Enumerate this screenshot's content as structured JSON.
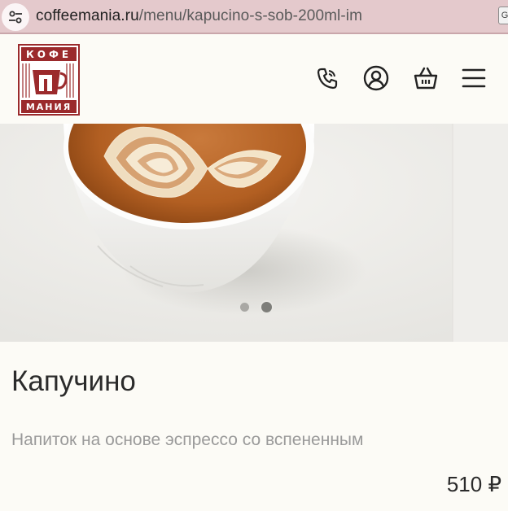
{
  "browser": {
    "url_domain": "coffeemania.ru",
    "url_path": "/menu/kapucino-s-sob-200ml-im",
    "extension_icon": "google-g-icon"
  },
  "header": {
    "logo_top_text": "КОФЕ",
    "logo_bottom_text": "МАНИЯ",
    "icons": [
      "phone-icon",
      "user-icon",
      "basket-icon",
      "menu-icon"
    ],
    "brand_color": "#9b2a2c"
  },
  "carousel": {
    "slide_count": 2,
    "active_slide": 2
  },
  "product": {
    "name": "Капучино",
    "description": "Напиток на основе эспрессо со вспененным",
    "price": "510 ₽"
  }
}
